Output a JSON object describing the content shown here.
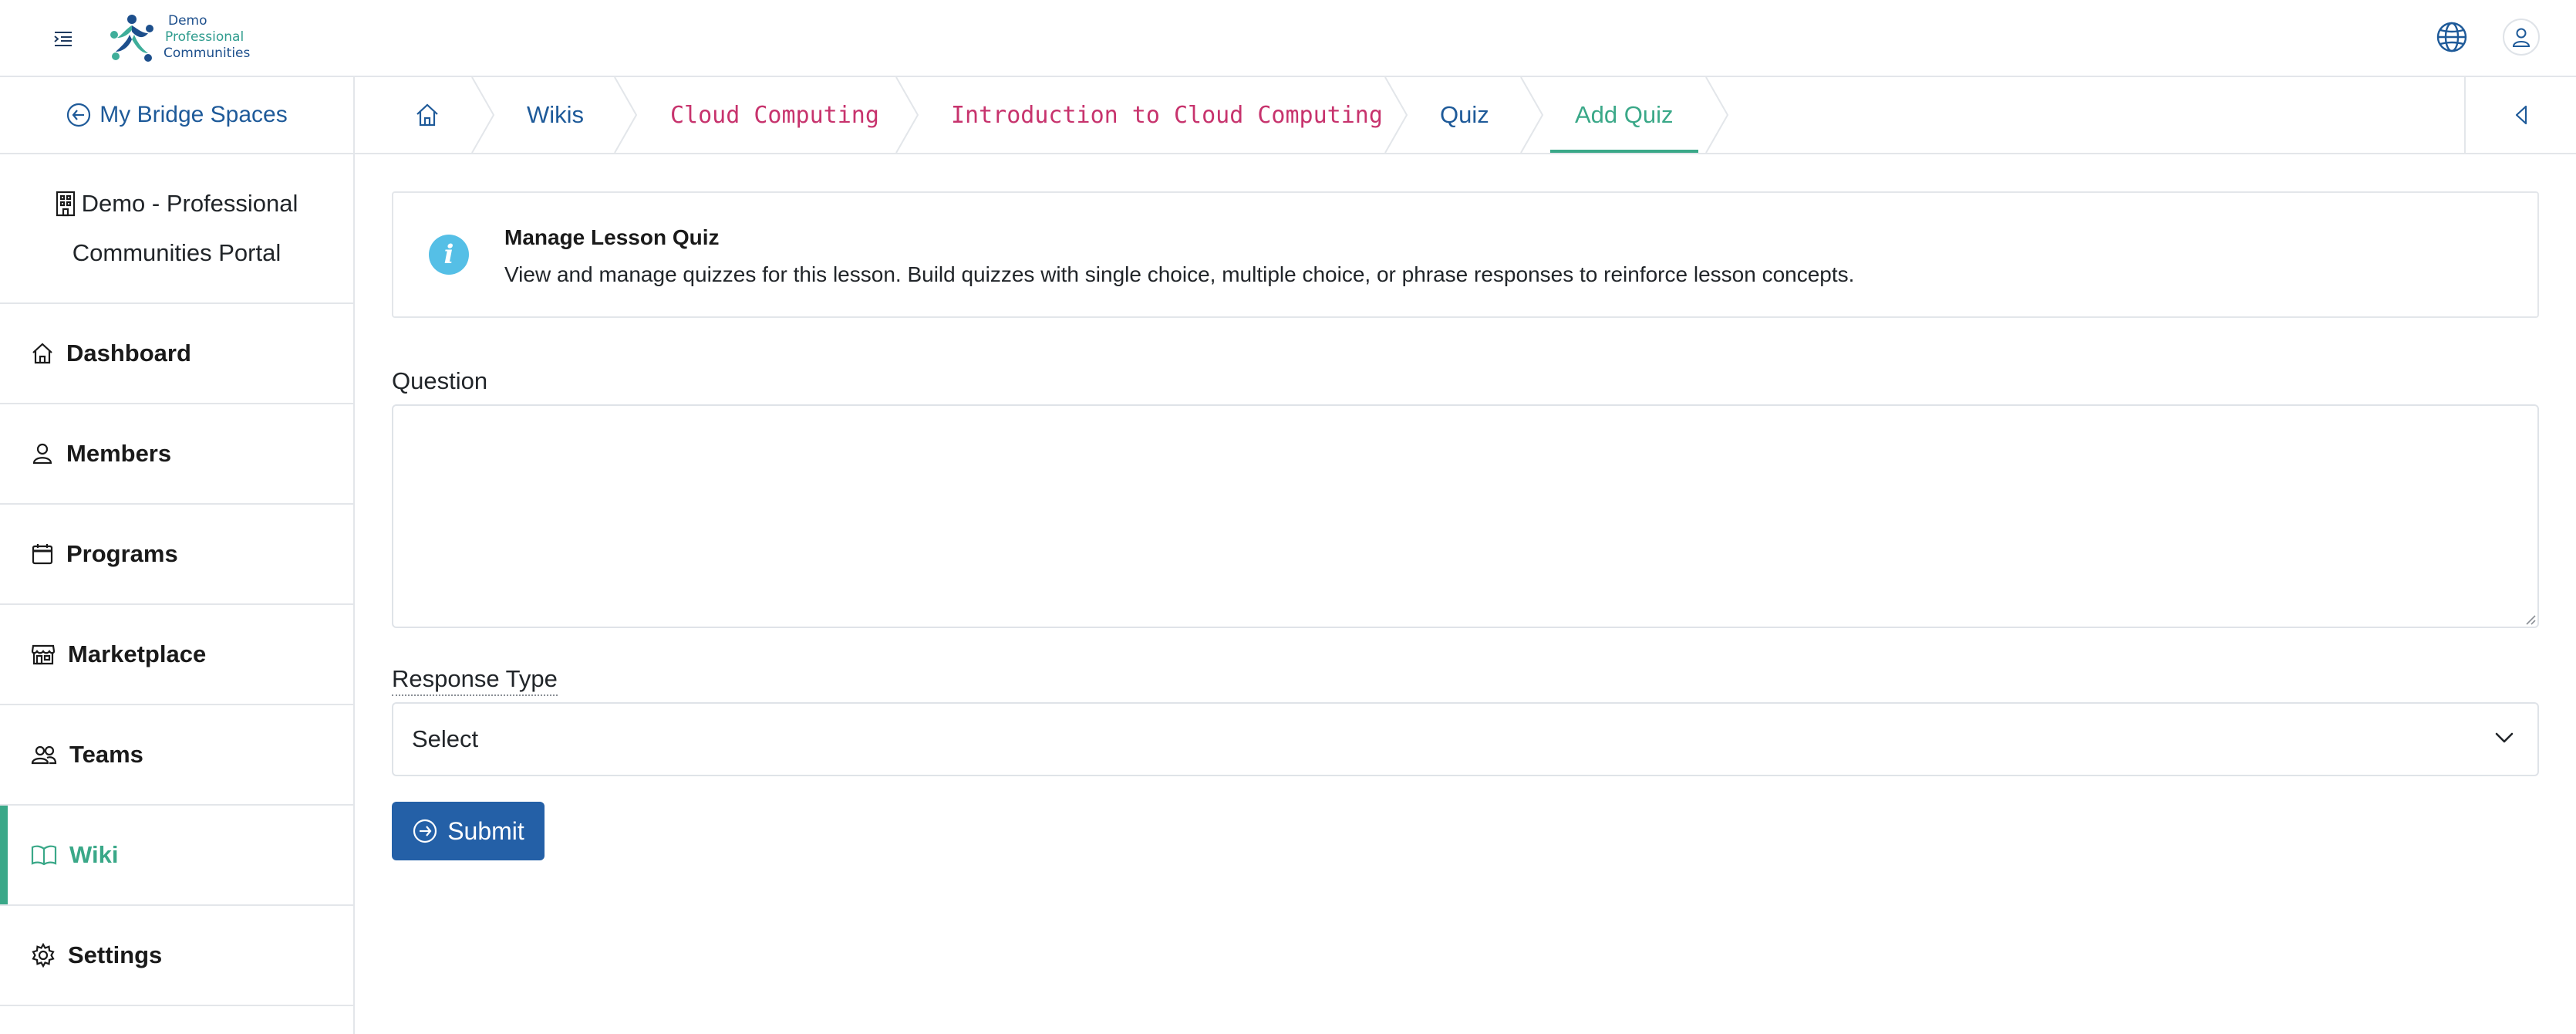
{
  "header": {
    "logo_lines": [
      "Demo",
      "Professional",
      "Communities"
    ],
    "menu_icon": "menu-collapse-icon",
    "globe_icon": "globe-icon",
    "user_icon": "user-icon"
  },
  "sidebar": {
    "back_label": "My Bridge Spaces",
    "org_line1": "Demo - Professional",
    "org_line2": "Communities Portal",
    "items": [
      {
        "label": "Dashboard",
        "icon": "home-icon"
      },
      {
        "label": "Members",
        "icon": "person-icon"
      },
      {
        "label": "Programs",
        "icon": "calendar-icon"
      },
      {
        "label": "Marketplace",
        "icon": "shop-icon"
      },
      {
        "label": "Teams",
        "icon": "people-icon"
      },
      {
        "label": "Wiki",
        "icon": "book-icon",
        "active": true
      },
      {
        "label": "Settings",
        "icon": "gear-icon"
      }
    ]
  },
  "breadcrumb": {
    "items": [
      "Wikis",
      "Cloud Computing",
      "Introduction to Cloud Computing",
      "Quiz",
      "Add Quiz"
    ]
  },
  "info": {
    "title": "Manage Lesson Quiz",
    "text": "View and manage quizzes for this lesson. Build quizzes with single choice, multiple choice, or phrase responses to reinforce lesson concepts."
  },
  "form": {
    "question_label": "Question",
    "question_value": "",
    "response_type_label": "Response Type",
    "response_type_value": "Select",
    "submit_label": "Submit"
  },
  "colors": {
    "primary": "#2460a7",
    "accent_green": "#3aa888",
    "code_pink": "#c7336d",
    "info_blue": "#55bfe6"
  }
}
